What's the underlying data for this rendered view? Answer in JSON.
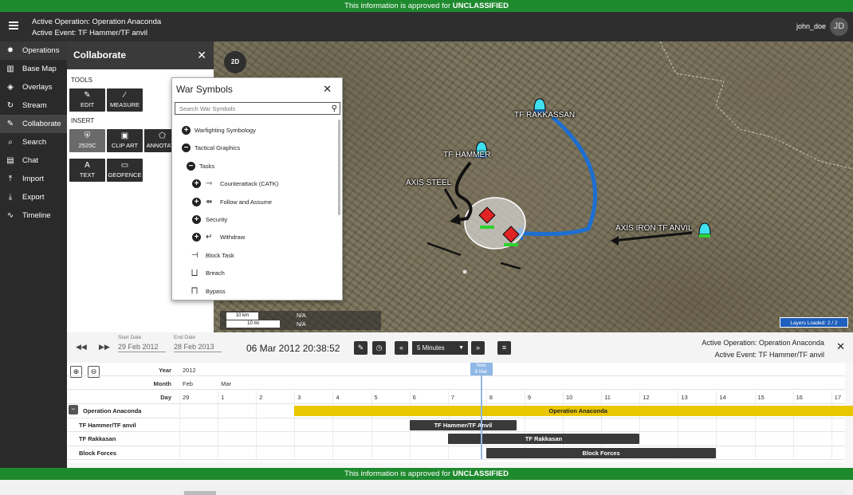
{
  "banner": {
    "prefix": "This information is approved for",
    "level": "UNCLASSIFIED"
  },
  "topbar": {
    "operation": "Active Operation: Operation Anaconda",
    "event": "Active Event: TF Hammer/TF anvil",
    "user": "john_doe",
    "avatar": "JD"
  },
  "nav": [
    {
      "label": "Operations",
      "icon": "runner-icon",
      "glyph": "✸"
    },
    {
      "label": "Base Map",
      "icon": "map-icon",
      "glyph": "▥"
    },
    {
      "label": "Overlays",
      "icon": "layers-icon",
      "glyph": "◈"
    },
    {
      "label": "Stream",
      "icon": "refresh-icon",
      "glyph": "↻"
    },
    {
      "label": "Collaborate",
      "icon": "pencil-icon",
      "glyph": "✎"
    },
    {
      "label": "Search",
      "icon": "search-icon",
      "glyph": "⌕"
    },
    {
      "label": "Chat",
      "icon": "chat-icon",
      "glyph": "▤"
    },
    {
      "label": "Import",
      "icon": "upload-icon",
      "glyph": "⤒"
    },
    {
      "label": "Export",
      "icon": "download-icon",
      "glyph": "⤓"
    },
    {
      "label": "Timeline",
      "icon": "timeline-icon",
      "glyph": "∿"
    }
  ],
  "collaborate": {
    "title": "Collaborate",
    "tools_label": "TOOLS",
    "insert_label": "INSERT",
    "tools": [
      {
        "label": "EDIT",
        "icon": "pencil-icon",
        "glyph": "✎"
      },
      {
        "label": "MEASURE",
        "icon": "ruler-icon",
        "glyph": "∕"
      }
    ],
    "insert": [
      {
        "label": "2525C",
        "icon": "shield-icon",
        "glyph": "⛨"
      },
      {
        "label": "CLIP ART",
        "icon": "image-icon",
        "glyph": "▣"
      },
      {
        "label": "ANNOTATE",
        "icon": "pentagon-icon",
        "glyph": "⬠"
      },
      {
        "label": "TEXT",
        "icon": "text-icon",
        "glyph": "A"
      },
      {
        "label": "GEOFENCE",
        "icon": "rectangle-icon",
        "glyph": "▭"
      }
    ]
  },
  "map": {
    "mode_button": "2D",
    "labels": {
      "tf_rakkassan": "TF RAKKASSAN",
      "tf_hammer": "TF HAMMER",
      "axis_steel": "AXIS STEEL",
      "axis_iron": "AXIS IRON TF ANVIL"
    },
    "scale": {
      "km": "10 km",
      "mi": "10 mi",
      "na1": "N/A",
      "na2": "N/A"
    },
    "layers_loaded": "Layers Loaded: 2 / 2"
  },
  "war_symbols": {
    "title": "War Symbols",
    "search_placeholder": "Search War Symbols",
    "tree": [
      {
        "label": "Warfighting Symbology",
        "toggle": "+",
        "indent": 0
      },
      {
        "label": "Tactical Graphics",
        "toggle": "−",
        "indent": 0
      },
      {
        "label": "Tasks",
        "toggle": "−",
        "indent": 1
      },
      {
        "label": "Counterattack (CATK)",
        "toggle": "+",
        "indent": 2,
        "sym": "⇾"
      },
      {
        "label": "Follow and Assume",
        "toggle": "+",
        "indent": 2,
        "sym": "⇴"
      },
      {
        "label": "Security",
        "toggle": "+",
        "indent": 2
      },
      {
        "label": "Withdraw",
        "toggle": "+",
        "indent": 2,
        "sym": "↵"
      },
      {
        "label": "Block Task",
        "toggle": "",
        "indent": 2,
        "sym": "⊣"
      },
      {
        "label": "Breach",
        "toggle": "",
        "indent": 2,
        "sym": "⨆"
      },
      {
        "label": "Bypass",
        "toggle": "",
        "indent": 2,
        "sym": "⨅"
      }
    ]
  },
  "timeline": {
    "start_label": "Start Date",
    "start_value": "29 Feb 2012",
    "end_label": "End Date",
    "end_value": "28 Feb 2013",
    "current_time": "06 Mar 2012 20:38:52",
    "step": "5 Minutes",
    "operation": "Active Operation: Operation Anaconda",
    "event": "Active Event: TF Hammer/TF anvil",
    "header_labels": {
      "year": "Year",
      "month": "Month",
      "day": "Day"
    },
    "year": "2012",
    "months": [
      "Feb",
      "Mar"
    ],
    "days": [
      "29",
      "1",
      "2",
      "3",
      "4",
      "5",
      "6",
      "7",
      "8",
      "9",
      "10",
      "11",
      "12",
      "13",
      "14",
      "15",
      "16",
      "17"
    ],
    "now_tag": {
      "line1": "Now",
      "line2": "6 Mar"
    },
    "rows": [
      {
        "label": "Operation Anaconda",
        "bar": "Operation Anaconda",
        "start": 2,
        "end": 16.8,
        "style": "yellow",
        "collapsible": true
      },
      {
        "label": "TF Hammer/TF anvil",
        "bar": "TF Hammer/TF Anvil",
        "start": 5,
        "end": 7.8,
        "style": "dark"
      },
      {
        "label": "TF Rakkasan",
        "bar": "TF Rakkasan",
        "start": 6,
        "end": 11,
        "style": "dark"
      },
      {
        "label": "Block Forces",
        "bar": "Block Forces",
        "start": 7,
        "end": 13,
        "style": "dark"
      }
    ],
    "now_day": 6.85
  }
}
